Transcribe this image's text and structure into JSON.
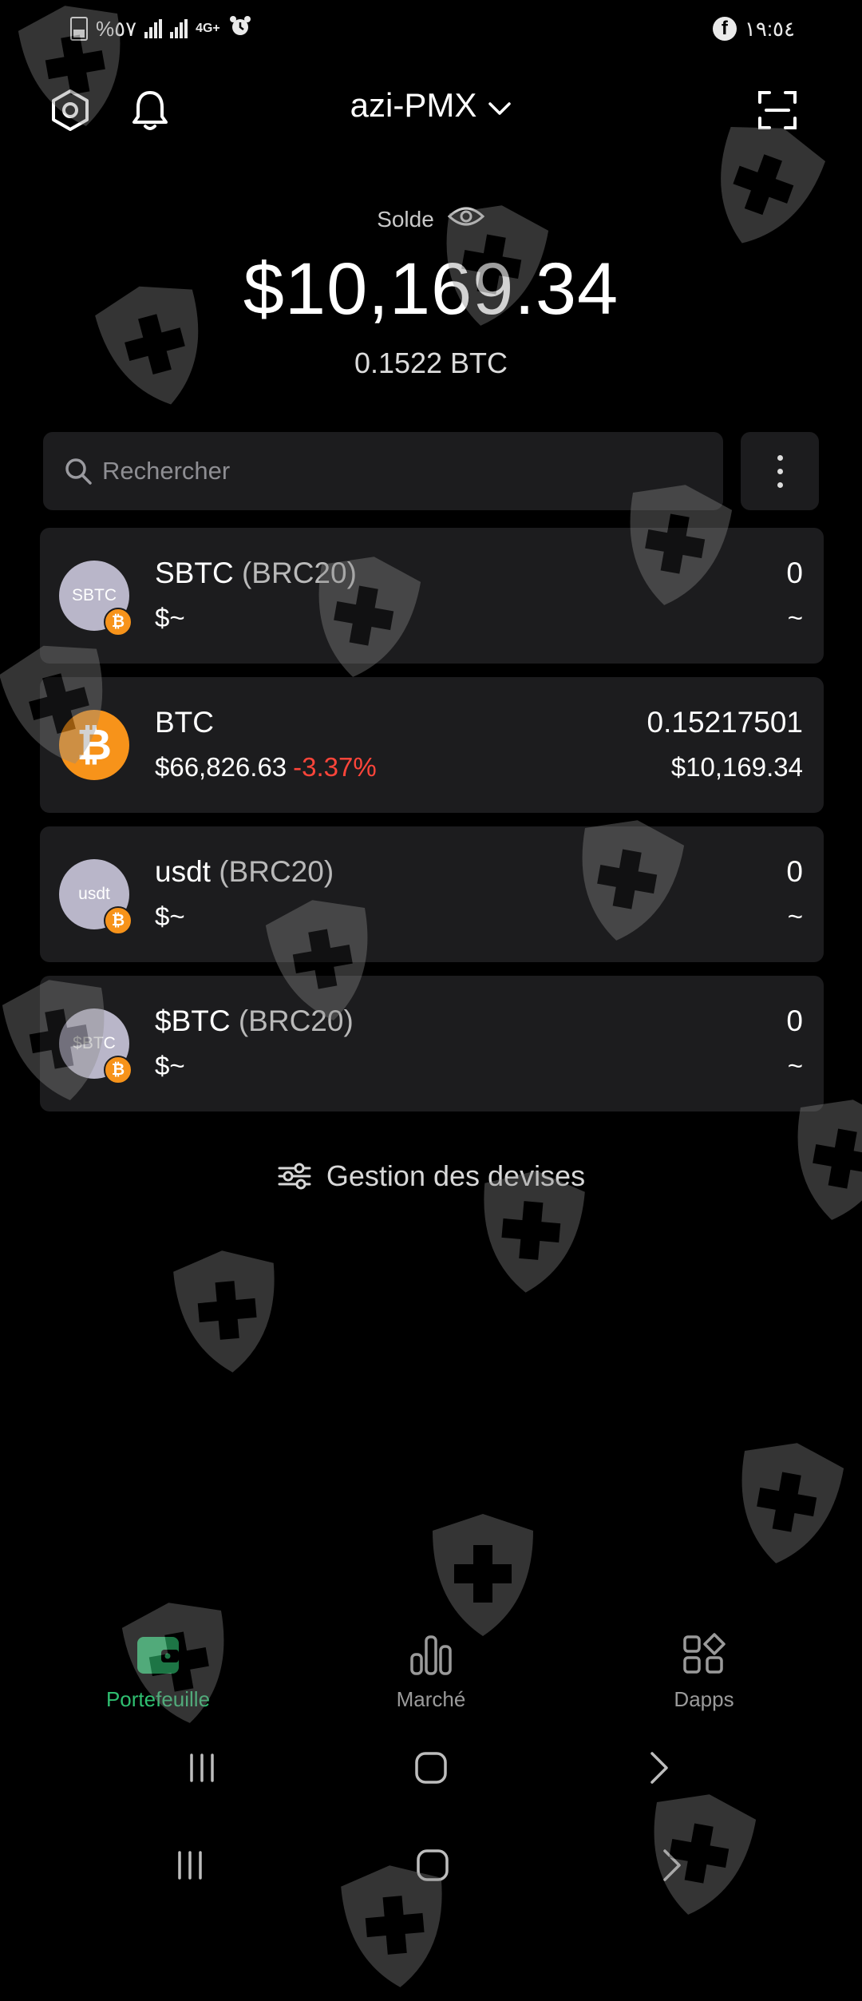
{
  "status_bar": {
    "battery": "%٥٧",
    "network": "4G+",
    "time": "١٩:٥٤"
  },
  "header": {
    "wallet_name": "azi-PMX",
    "icons": [
      "settings-hex-icon",
      "bell-icon",
      "chevron-down-icon",
      "scan-icon"
    ]
  },
  "balance": {
    "label": "Solde",
    "amount": "$10,169.34",
    "btc": "0.1522 BTC"
  },
  "search": {
    "placeholder": "Rechercher"
  },
  "tokens": [
    {
      "icon_text": "SBTC",
      "name": "SBTC",
      "tag": "(BRC20)",
      "price": "$~",
      "change": "",
      "amount": "0",
      "value": "~",
      "icon_color": "#b9b6c9"
    },
    {
      "icon_text": "₿",
      "name": "BTC",
      "tag": "",
      "price": "$66,826.63",
      "change": "-3.37%",
      "amount": "0.15217501",
      "value": "$10,169.34",
      "icon_color": "#f7931a"
    },
    {
      "icon_text": "usdt",
      "name": "usdt",
      "tag": "(BRC20)",
      "price": "$~",
      "change": "",
      "amount": "0",
      "value": "~",
      "icon_color": "#b9b6c9"
    },
    {
      "icon_text": "$BTC",
      "name": "$BTC",
      "tag": "(BRC20)",
      "price": "$~",
      "change": "",
      "amount": "0",
      "value": "~",
      "icon_color": "#b9b6c9"
    }
  ],
  "manage": {
    "label": "Gestion des devises"
  },
  "bottom_nav": {
    "items": [
      {
        "label": "Portefeuille",
        "icon": "wallet-icon",
        "active": true
      },
      {
        "label": "Marché",
        "icon": "market-chart-icon",
        "active": false
      },
      {
        "label": "Dapps",
        "icon": "apps-grid-icon",
        "active": false
      }
    ]
  },
  "colors": {
    "background": "#000000",
    "card": "#1c1c1e",
    "accent_green": "#2fbf71",
    "negative_red": "#ff453a",
    "btc_orange": "#f7931a"
  }
}
